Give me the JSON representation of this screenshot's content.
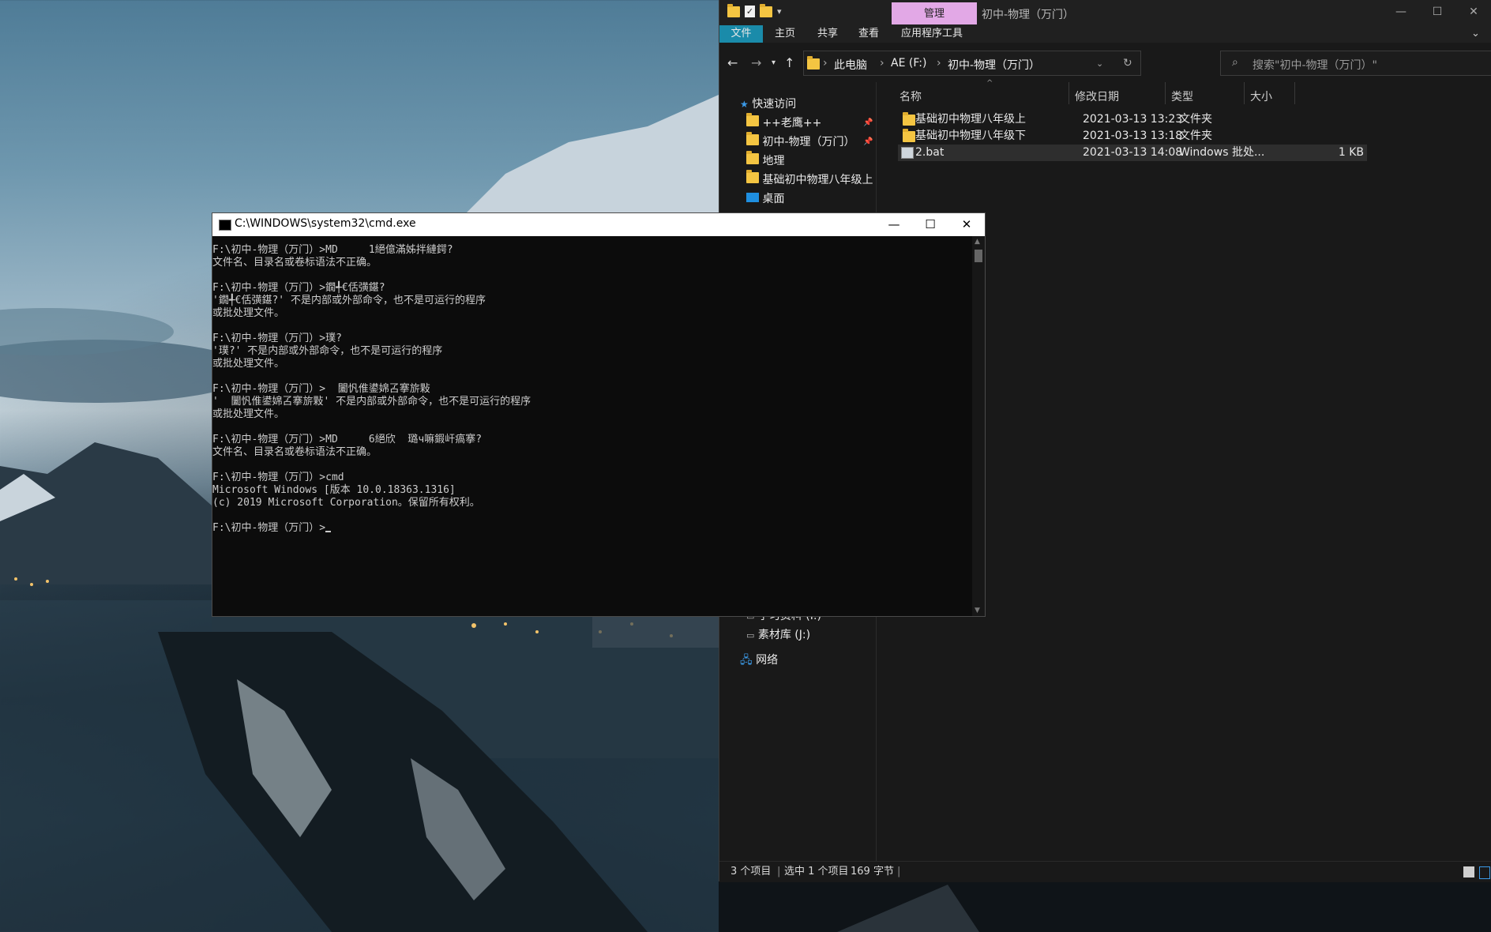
{
  "explorer": {
    "tab_manage": "管理",
    "title": "初中-物理（万门）",
    "window_buttons": [
      "—",
      "☐",
      "✕"
    ],
    "ribbon": [
      "文件",
      "主页",
      "共享",
      "查看",
      "应用程序工具"
    ],
    "breadcrumb": [
      "此电脑",
      "AE (F:)",
      "初中-物理（万门）"
    ],
    "search_placeholder": "搜索\"初中-物理（万门）\"",
    "nav": {
      "quick_access": "快速访问",
      "items": [
        "++老鹰++",
        "初中-物理（万门）",
        "地理",
        "基础初中物理八年级上",
        "桌面"
      ],
      "drives": [
        "学习资料 (I:)",
        "素材库 (J:)"
      ],
      "network": "网络"
    },
    "columns": [
      "名称",
      "修改日期",
      "类型",
      "大小"
    ],
    "rows": [
      {
        "name": "基础初中物理八年级上",
        "date": "2021-03-13 13:23",
        "type": "文件夹",
        "size": ""
      },
      {
        "name": "基础初中物理八年级下",
        "date": "2021-03-13 13:18",
        "type": "文件夹",
        "size": ""
      },
      {
        "name": "2.bat",
        "date": "2021-03-13 14:08",
        "type": "Windows 批处...",
        "size": "1 KB"
      }
    ],
    "status": {
      "count": "3 个项目",
      "selected": "选中 1 个项目",
      "size": "169 字节"
    }
  },
  "cmd": {
    "title": "C:\\WINDOWS\\system32\\cmd.exe",
    "lines": [
      "F:\\初中-物理（万门）>MD     1絕億滿姊拌縺鍔?",
      "文件名、目录名或卷标语法不正确。",
      "",
      "F:\\初中-物理（万门）>鐗╃€佸彉鍖?",
      "'鐗╃€佸彉鍖?' 不是内部或外部命令，也不是可运行的程序",
      "或批处理文件。",
      "",
      "F:\\初中-物理（万门）>璞?",
      "'璞?' 不是内部或外部命令，也不是可运行的程序",
      "或批处理文件。",
      "",
      "F:\\初中-物理（万门）>  闔忛倠鍙婂叾搴旂敤",
      "'  闔忛倠鍙婂叾搴旂敤' 不是内部或外部命令，也不是可运行的程序",
      "或批处理文件。",
      "",
      "F:\\初中-物理（万门）>MD     6絕欣  璐ч嘛鍜屽瘑搴?",
      "文件名、目录名或卷标语法不正确。",
      "",
      "F:\\初中-物理（万门）>cmd",
      "Microsoft Windows [版本 10.0.18363.1316]",
      "(c) 2019 Microsoft Corporation。保留所有权利。",
      "",
      "F:\\初中-物理（万门）>"
    ]
  }
}
